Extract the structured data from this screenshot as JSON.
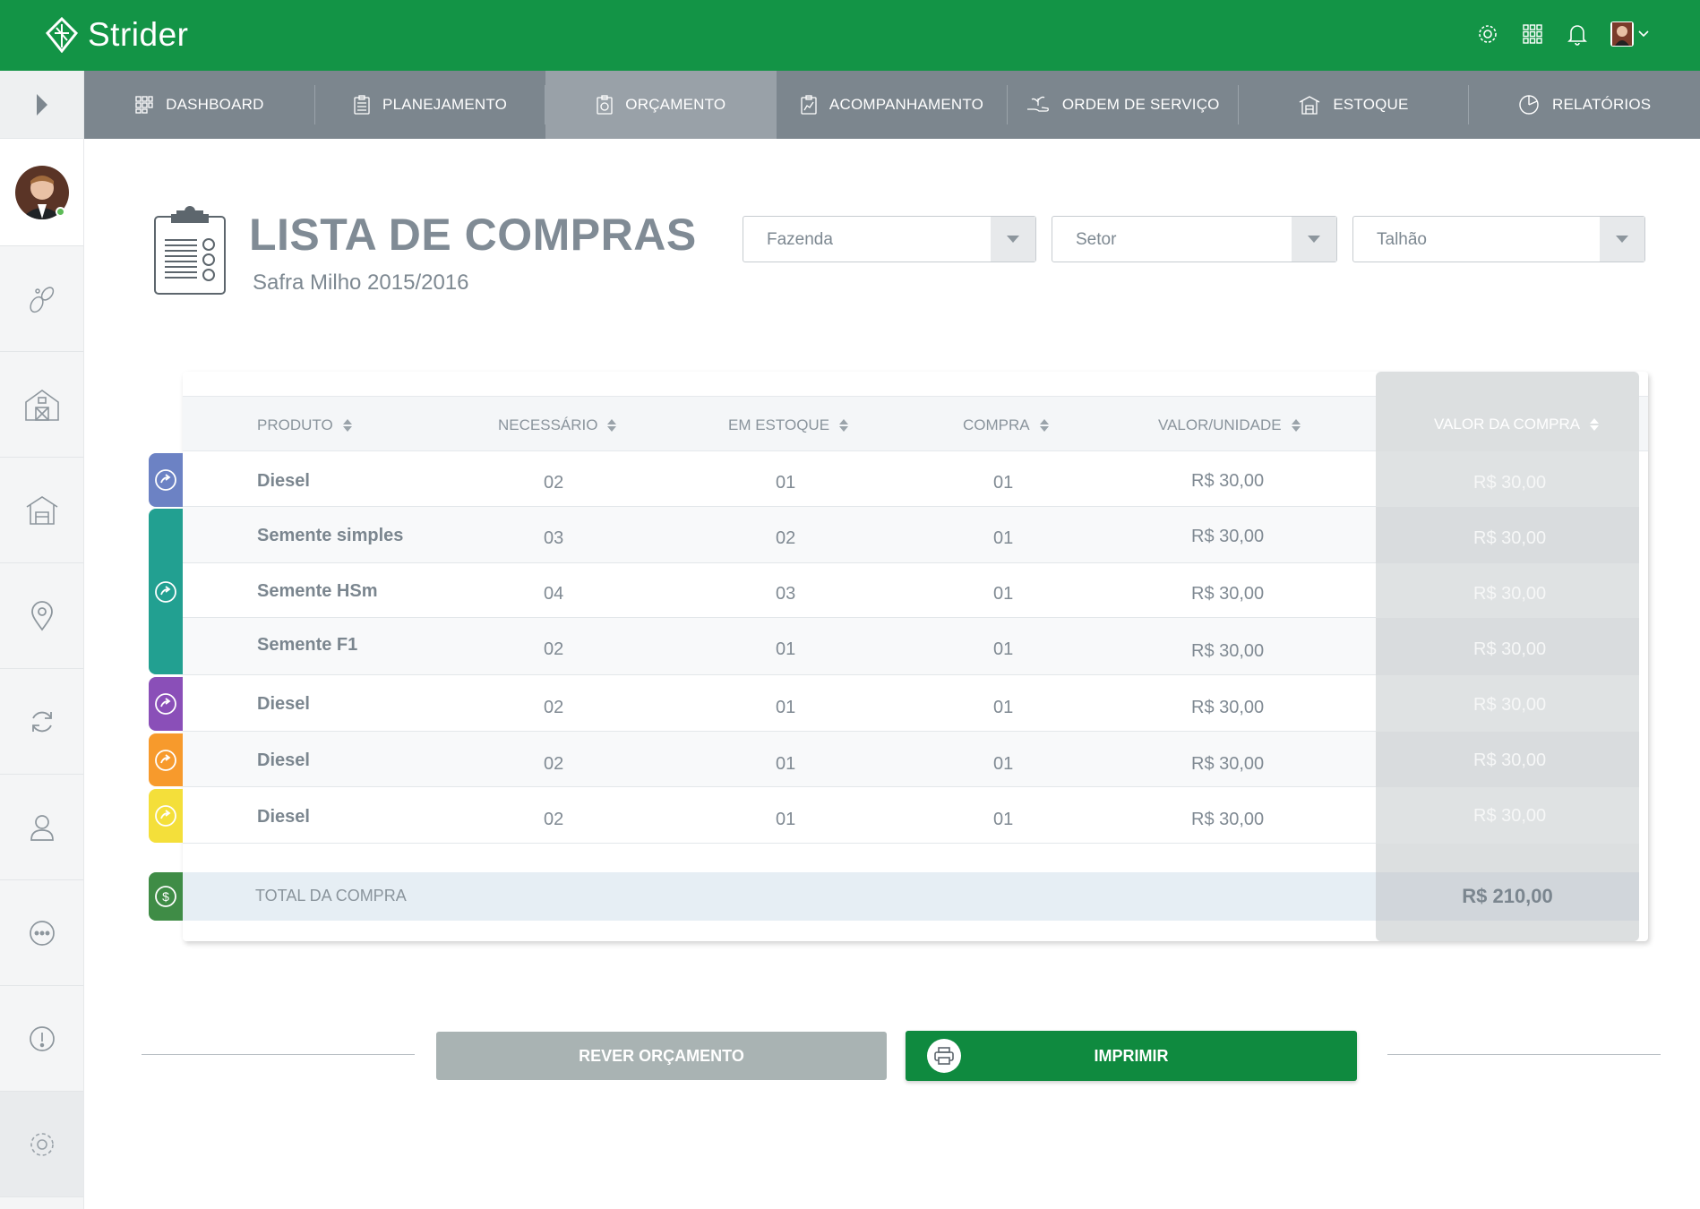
{
  "app": {
    "name": "Strider"
  },
  "colors": {
    "brand_green": "#139446",
    "nav_bg": "#7c868e",
    "nav_active": "#99a1a8",
    "print_green": "#0f8a3f"
  },
  "topbar": {
    "icons": [
      "settings-icon",
      "apps-grid-icon",
      "bell-icon",
      "user-avatar"
    ]
  },
  "nav": {
    "tabs": [
      {
        "label": "DASHBOARD",
        "icon": "dashboard-icon"
      },
      {
        "label": "PLANEJAMENTO",
        "icon": "clipboard-icon"
      },
      {
        "label": "ORÇAMENTO",
        "icon": "budget-icon",
        "active": true
      },
      {
        "label": "ACOMPANHAMENTO",
        "icon": "chart-clipboard-icon"
      },
      {
        "label": "ORDEM DE SERVIÇO",
        "icon": "hand-plant-icon"
      },
      {
        "label": "ESTOQUE",
        "icon": "warehouse-icon"
      },
      {
        "label": "RELATÓRIOS",
        "icon": "pie-chart-icon"
      }
    ]
  },
  "sidebar": {
    "items": [
      "seeds-icon",
      "barn-icon",
      "storage-icon",
      "location-icon",
      "sync-icon",
      "user-icon",
      "more-icon",
      "info-icon",
      "settings-icon"
    ]
  },
  "page": {
    "title": "LISTA DE COMPRAS",
    "subtitle": "Safra Milho 2015/2016"
  },
  "filters": {
    "fazenda": "Fazenda",
    "setor": "Setor",
    "talhao": "Talhão"
  },
  "table": {
    "headers": {
      "produto": "PRODUTO",
      "necessario": "NECESSÁRIO",
      "estoque": "EM ESTOQUE",
      "compra": "COMPRA",
      "valor_unidade": "VALOR/UNIDADE",
      "valor_compra": "VALOR DA COMPRA"
    },
    "rows": [
      {
        "produto": "Diesel",
        "necessario": "02",
        "estoque": "01",
        "compra": "01",
        "valor_unidade": "R$ 30,00",
        "valor_compra": "R$ 30,00"
      },
      {
        "produto": "Semente simples",
        "necessario": "03",
        "estoque": "02",
        "compra": "01",
        "valor_unidade": "R$ 30,00",
        "valor_compra": "R$ 30,00"
      },
      {
        "produto": "Semente HSm",
        "necessario": "04",
        "estoque": "03",
        "compra": "01",
        "valor_unidade": "R$ 30,00",
        "valor_compra": "R$ 30,00"
      },
      {
        "produto": "Semente F1",
        "necessario": "02",
        "estoque": "01",
        "compra": "01",
        "valor_unidade": "R$ 30,00",
        "valor_compra": "R$ 30,00"
      },
      {
        "produto": "Diesel",
        "necessario": "02",
        "estoque": "01",
        "compra": "01",
        "valor_unidade": "R$ 30,00",
        "valor_compra": "R$ 30,00"
      },
      {
        "produto": "Diesel",
        "necessario": "02",
        "estoque": "01",
        "compra": "01",
        "valor_unidade": "R$ 30,00",
        "valor_compra": "R$ 30,00"
      },
      {
        "produto": "Diesel",
        "necessario": "02",
        "estoque": "01",
        "compra": "01",
        "valor_unidade": "R$ 30,00",
        "valor_compra": "R$ 30,00"
      }
    ],
    "group_colors": [
      "#6c82c4",
      "#22a091",
      "#8a4fb8",
      "#f79a2c",
      "#f4df3a"
    ],
    "total_label": "TOTAL DA COMPRA",
    "total_value": "R$ 210,00"
  },
  "actions": {
    "review": "REVER ORÇAMENTO",
    "print": "IMPRIMIR"
  }
}
